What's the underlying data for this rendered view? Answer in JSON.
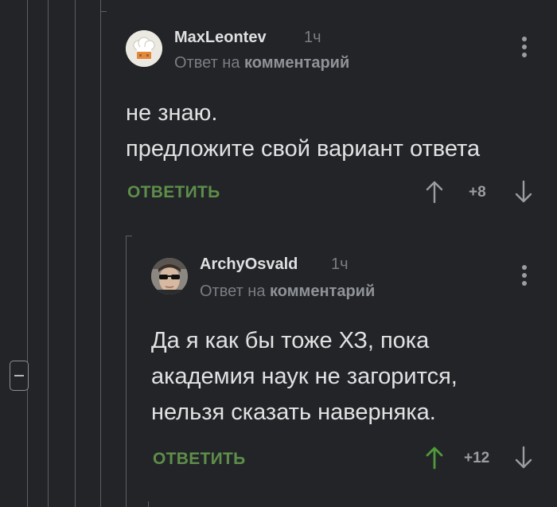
{
  "comments": [
    {
      "author": "MaxLeontev",
      "time": "1ч",
      "reply_prefix": "Ответ на",
      "reply_target": "комментарий",
      "text_lines": [
        "не знаю.",
        "предложите свой вариант ответа"
      ],
      "reply_label": "ОТВЕТИТЬ",
      "rating": "+8",
      "upvoted": false,
      "avatar": "chef-hat-avatar"
    },
    {
      "author": "ArchyOsvald",
      "time": "1ч",
      "reply_prefix": "Ответ на",
      "reply_target": "комментарий",
      "text_lines": [
        "Да я как бы тоже ХЗ, пока",
        "академия наук не загорится,",
        "нельзя сказать наверняка."
      ],
      "reply_label": "ОТВЕТИТЬ",
      "rating": "+12",
      "upvoted": true,
      "avatar": "sunglasses-person-avatar"
    }
  ],
  "colors": {
    "background": "#222428",
    "thread_line": "#5b5e63",
    "reply_green": "#5e8e4a",
    "upvote_active": "#4f9a3a",
    "vote_inactive": "#9a9da2"
  }
}
